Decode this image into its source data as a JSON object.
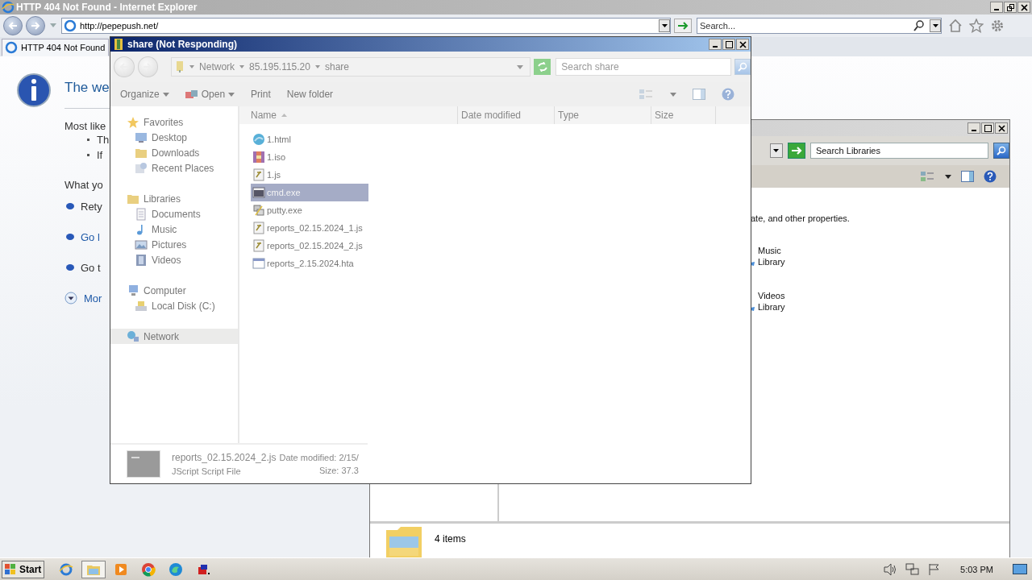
{
  "ie": {
    "title": "HTTP 404 Not Found - Internet Explorer",
    "address": "http://pepepush.net/",
    "search_placeholder": "Search...",
    "tabs": [
      {
        "label": "HTTP 404 Not Found",
        "selected": true
      }
    ],
    "page": {
      "heading": "The we",
      "intro": "Most like",
      "bullets": [
        "Th",
        "If"
      ],
      "prompt": "What yo",
      "actions": [
        {
          "text": "Rety",
          "kind": "text"
        },
        {
          "text": "Go l",
          "kind": "link"
        },
        {
          "text": "Go t",
          "kind": "text"
        }
      ],
      "more": "Mor"
    }
  },
  "libraries_window": {
    "search_placeholder": "Search Libraries",
    "description": "ate, and other properties.",
    "libraries": [
      {
        "name": "Music",
        "type": "Library"
      },
      {
        "name": "Videos",
        "type": "Library"
      }
    ],
    "status": "4 items"
  },
  "explorer": {
    "title": "share (Not Responding)",
    "breadcrumb": [
      "Network",
      "85.195.115.20",
      "share"
    ],
    "search_placeholder": "Search share",
    "toolbar": [
      {
        "label": "Organize",
        "kind": "menu"
      },
      {
        "label": "Open",
        "kind": "open"
      },
      {
        "label": "Print",
        "kind": "plain"
      },
      {
        "label": "New folder",
        "kind": "plain"
      }
    ],
    "nav": [
      {
        "label": "Favorites",
        "kind": "star",
        "selected": false,
        "children": [
          {
            "label": "Desktop",
            "kind": "desktop",
            "selected": false
          },
          {
            "label": "Downloads",
            "kind": "folder",
            "selected": false
          },
          {
            "label": "Recent Places",
            "kind": "places",
            "selected": false
          }
        ]
      },
      {
        "label": "Libraries",
        "kind": "folder",
        "selected": false,
        "children": [
          {
            "label": "Documents",
            "kind": "document",
            "selected": false
          },
          {
            "label": "Music",
            "kind": "music",
            "selected": false
          },
          {
            "label": "Pictures",
            "kind": "picture",
            "selected": false
          },
          {
            "label": "Videos",
            "kind": "film",
            "selected": false
          }
        ]
      },
      {
        "label": "Computer",
        "kind": "computer",
        "selected": false,
        "children": [
          {
            "label": "Local Disk (C:)",
            "kind": "disk",
            "selected": false
          }
        ]
      },
      {
        "label": "Network",
        "kind": "network",
        "selected": true
      }
    ],
    "columns": [
      {
        "label": "Name",
        "sorted": true
      },
      {
        "label": "Date modified",
        "sorted": false
      },
      {
        "label": "Type",
        "sorted": false
      },
      {
        "label": "Size",
        "sorted": false
      }
    ],
    "files": [
      {
        "name": "1.html",
        "kind": "web",
        "selected": false
      },
      {
        "name": "1.iso",
        "kind": "archive",
        "selected": false
      },
      {
        "name": "1.js",
        "kind": "script",
        "selected": false
      },
      {
        "name": "cmd.exe",
        "kind": "console",
        "selected": true
      },
      {
        "name": "putty.exe",
        "kind": "program",
        "selected": false
      },
      {
        "name": "reports_02.15.2024_1.js",
        "kind": "script",
        "selected": false
      },
      {
        "name": "reports_02.15.2024_2.js",
        "kind": "script",
        "selected": false
      },
      {
        "name": "reports_2.15.2024.hta",
        "kind": "window",
        "selected": false
      }
    ],
    "details": {
      "name": "reports_02.15.2024_2.js",
      "type": "JScript Script File",
      "date": "Date modified: 2/15/",
      "size": "Size: 37.3"
    }
  },
  "taskbar": {
    "start": "Start",
    "apps": [
      {
        "kind": "ie",
        "selected": false
      },
      {
        "kind": "explorer",
        "selected": true
      },
      {
        "kind": "media",
        "selected": false
      },
      {
        "kind": "chrome",
        "selected": false
      },
      {
        "kind": "edge",
        "selected": false
      },
      {
        "kind": "app",
        "selected": false
      }
    ],
    "clock": "5:03 PM"
  }
}
